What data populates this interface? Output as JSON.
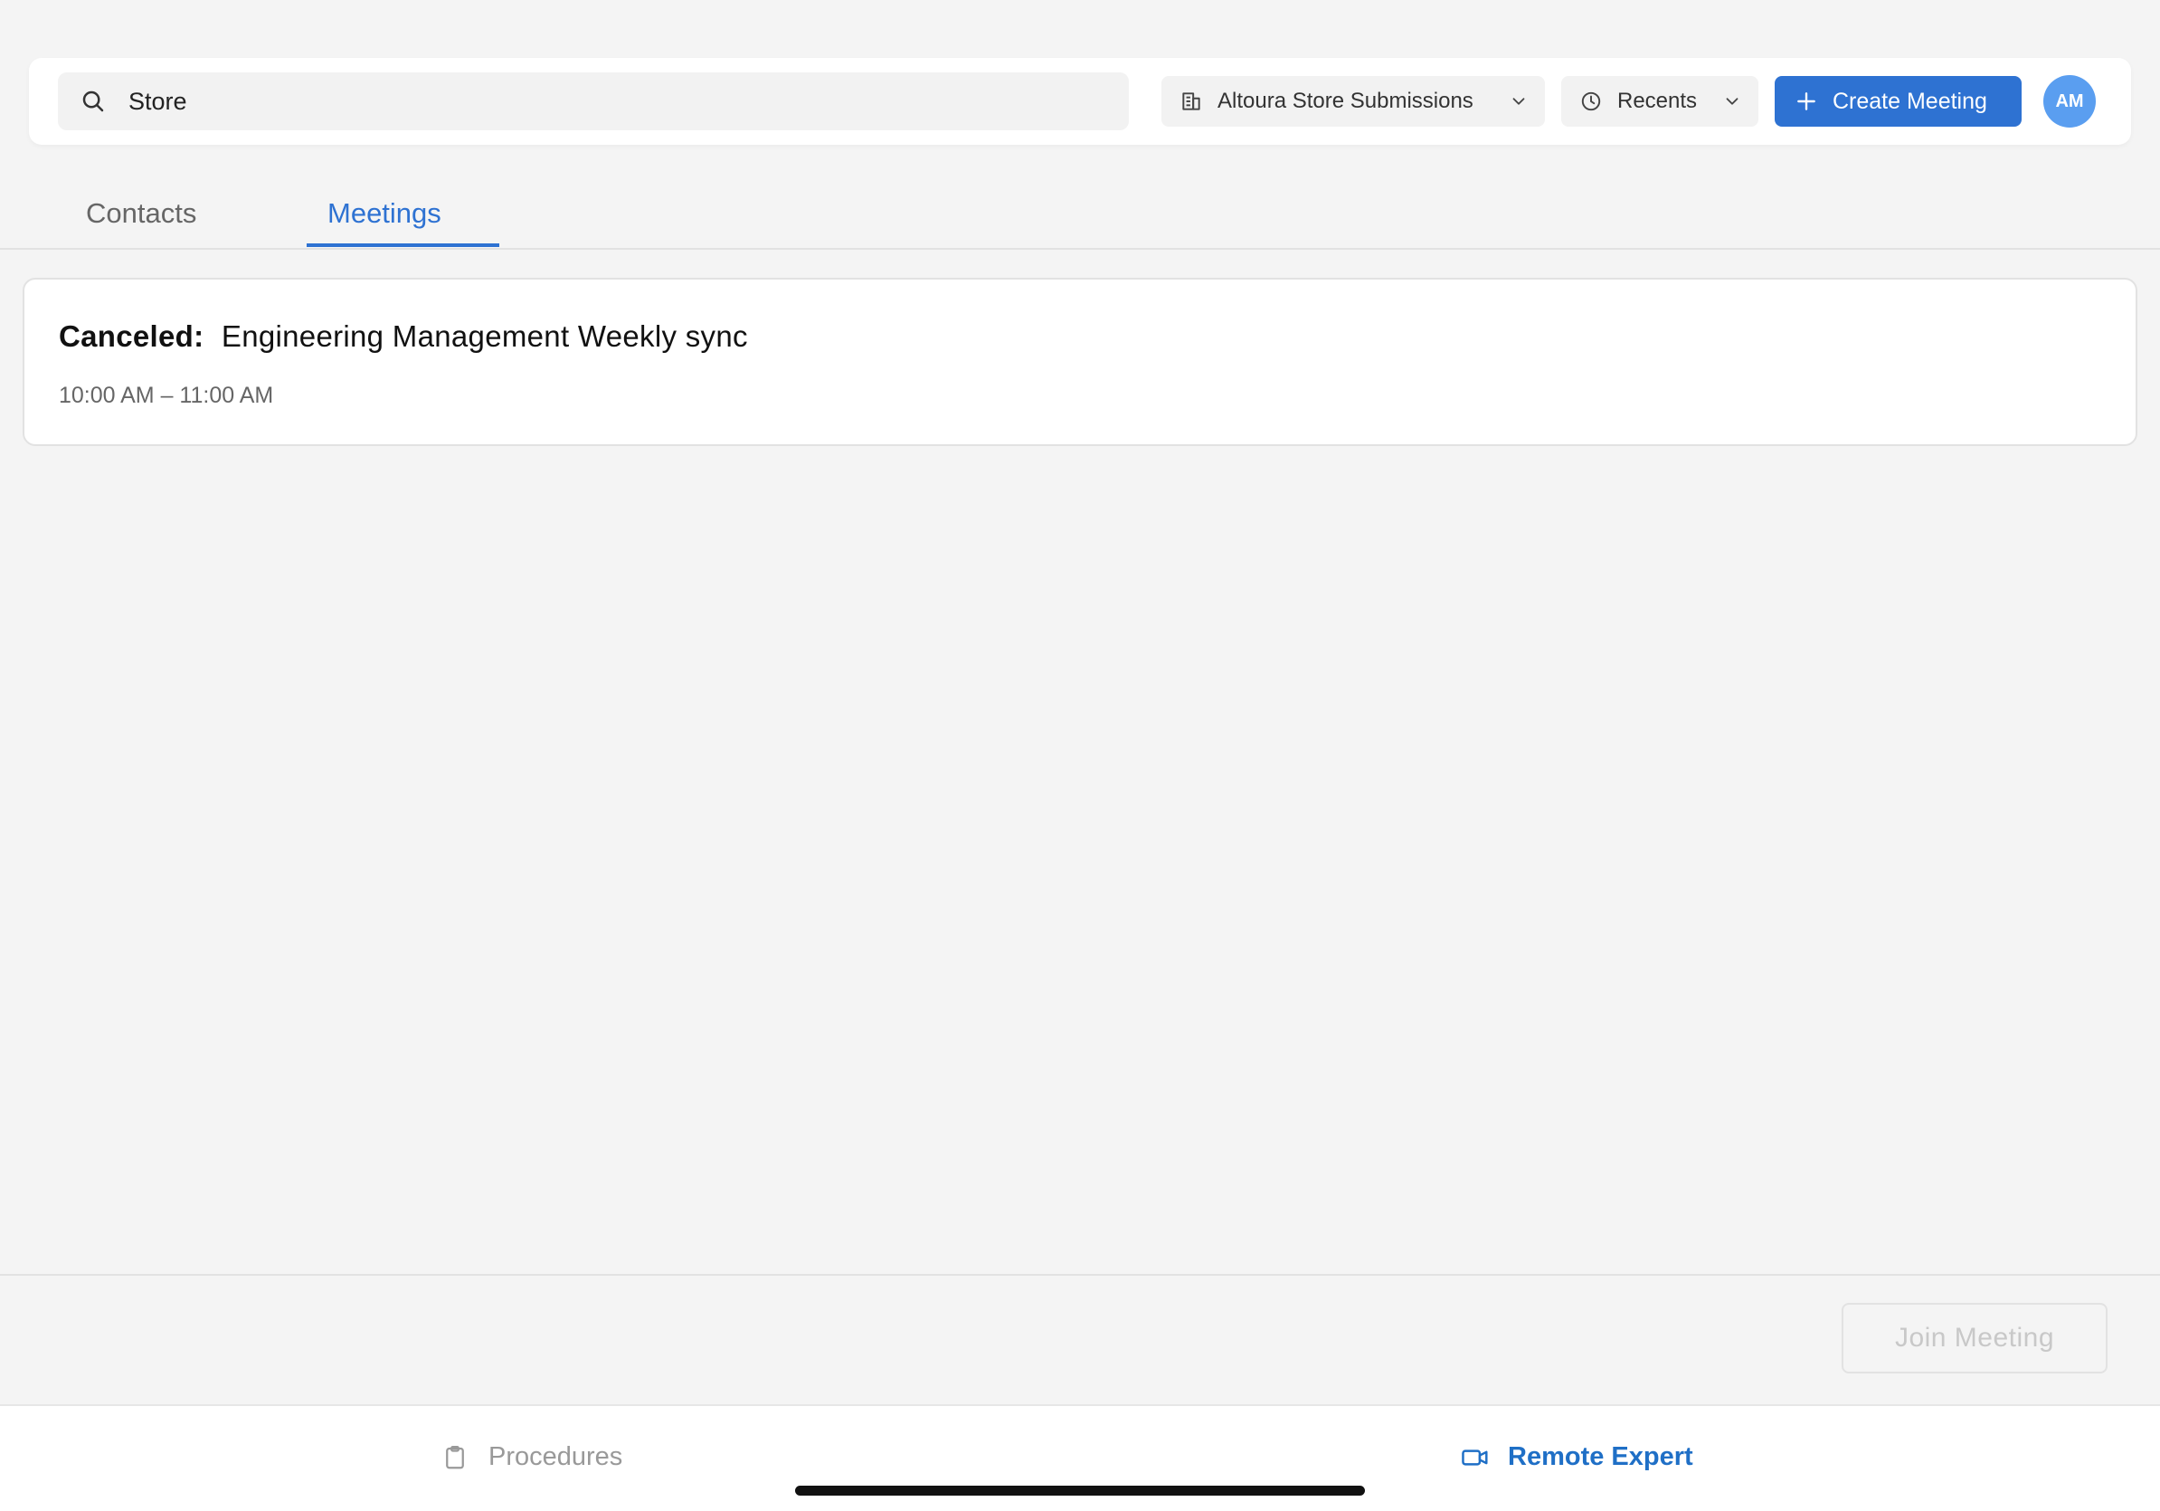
{
  "header": {
    "search": {
      "value": "Store",
      "placeholder": "Search"
    },
    "workspace_dropdown": {
      "label": "Altoura Store Submissions"
    },
    "recents_dropdown": {
      "label": "Recents"
    },
    "create_button": {
      "label": "Create Meeting"
    },
    "avatar": {
      "initials": "AM"
    }
  },
  "tabs": [
    {
      "label": "Contacts",
      "active": false
    },
    {
      "label": "Meetings",
      "active": true
    }
  ],
  "meetings": [
    {
      "status": "Canceled:",
      "title": "Engineering Management Weekly sync",
      "time": "10:00 AM – 11:00 AM"
    }
  ],
  "actions": {
    "join_button": {
      "label": "Join Meeting",
      "enabled": false
    }
  },
  "bottom_nav": [
    {
      "label": "Procedures",
      "icon": "clipboard-icon",
      "active": false
    },
    {
      "label": "Remote Expert",
      "icon": "video-camera-icon",
      "active": true
    }
  ],
  "colors": {
    "accent": "#2e72d2",
    "avatar": "#5a9ef0",
    "background": "#f4f4f4"
  }
}
